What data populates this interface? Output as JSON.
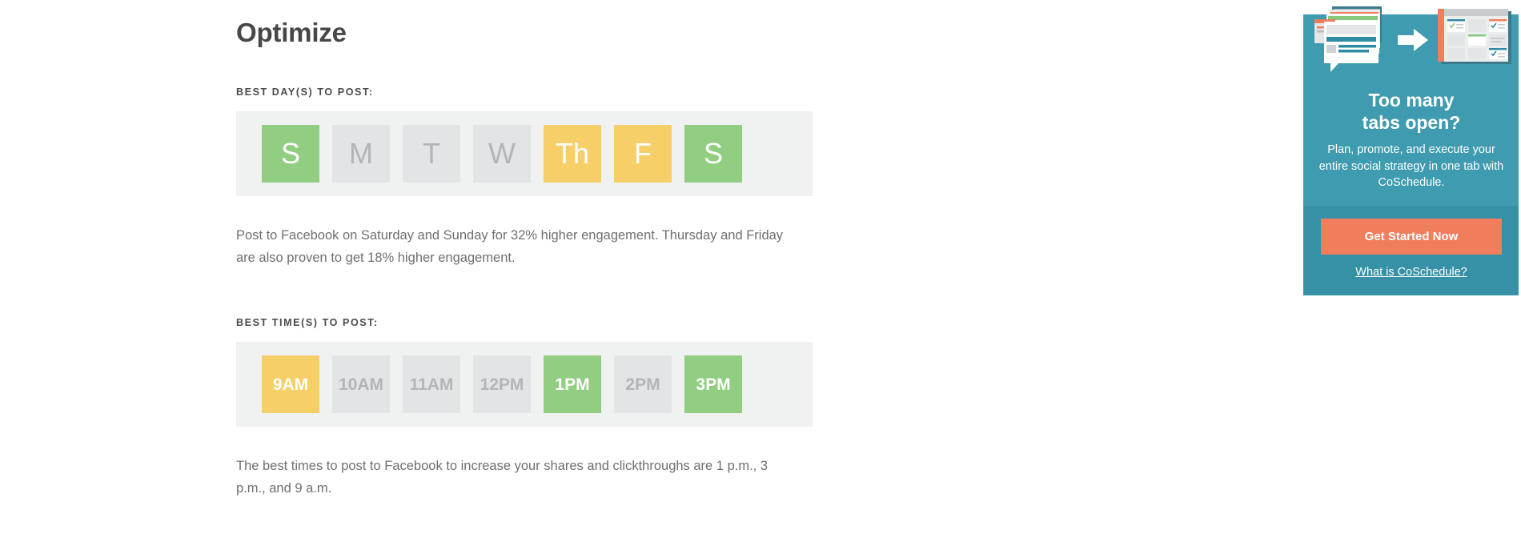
{
  "page": {
    "title": "Optimize"
  },
  "day_section": {
    "label": "BEST DAY(S) TO POST:",
    "tiles": [
      {
        "name": "sunday",
        "label": "S",
        "state": "green"
      },
      {
        "name": "monday",
        "label": "M",
        "state": "off"
      },
      {
        "name": "tuesday",
        "label": "T",
        "state": "off"
      },
      {
        "name": "wednesday",
        "label": "W",
        "state": "off"
      },
      {
        "name": "thursday",
        "label": "Th",
        "state": "yellow"
      },
      {
        "name": "friday",
        "label": "F",
        "state": "yellow"
      },
      {
        "name": "saturday",
        "label": "S",
        "state": "green"
      }
    ],
    "description": "Post to Facebook on Saturday and Sunday for 32% higher engagement. Thursday and Friday are also proven to get 18% higher engagement."
  },
  "time_section": {
    "label": "BEST TIME(S) TO POST:",
    "tiles": [
      {
        "name": "9am",
        "label": "9AM",
        "state": "yellow"
      },
      {
        "name": "10am",
        "label": "10AM",
        "state": "off"
      },
      {
        "name": "11am",
        "label": "11AM",
        "state": "off"
      },
      {
        "name": "12pm",
        "label": "12PM",
        "state": "off"
      },
      {
        "name": "1pm",
        "label": "1PM",
        "state": "green"
      },
      {
        "name": "2pm",
        "label": "2PM",
        "state": "off"
      },
      {
        "name": "3pm",
        "label": "3PM",
        "state": "green"
      }
    ],
    "description": "The best times to post to Facebook to increase your shares and clickthroughs are 1 p.m., 3 p.m., and 9 a.m."
  },
  "ad": {
    "headline_line1": "Too many",
    "headline_line2": "tabs open?",
    "subtext": "Plan, promote, and execute your entire social strategy in one tab with CoSchedule.",
    "cta_label": "Get Started Now",
    "link_label": "What is CoSchedule?",
    "illustration_name": "tabs-to-calendar-illustration"
  },
  "colors": {
    "selected_green": "#92ce82",
    "selected_yellow": "#f7cf68",
    "inactive_gray": "#e3e4e5",
    "strip_background": "#f0f1f1",
    "ad_teal": "#3e9bb0",
    "ad_teal_dark": "#3791a6",
    "cta_orange": "#f07d5c",
    "heading_text": "#47474a",
    "body_text": "#6f6f72"
  }
}
